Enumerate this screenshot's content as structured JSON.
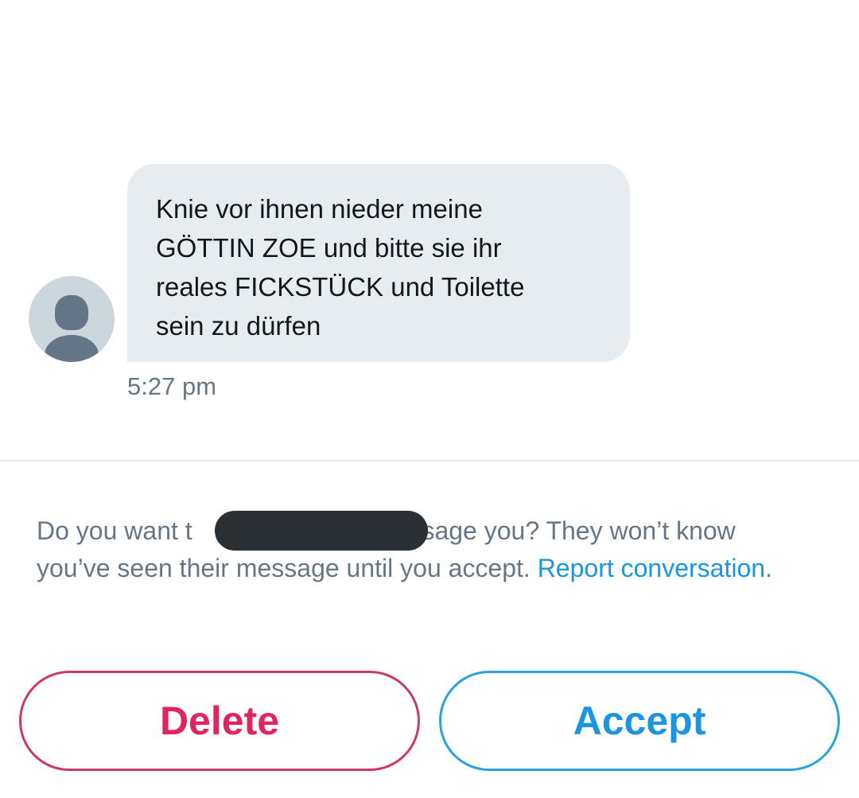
{
  "conversation": {
    "message": {
      "text": "Knie vor ihnen nieder meine GÖTTIN ZOE und bitte sie ihr reales FICKSTÜCK und Toilette sein zu dürfen",
      "time": "5:27 pm"
    }
  },
  "request": {
    "text_before": "Do you want t",
    "text_after": "essage you? They won’t know you’ve seen their message until you accept. ",
    "report_link": "Report conversation."
  },
  "actions": {
    "delete_label": "Delete",
    "accept_label": "Accept"
  },
  "colors": {
    "delete": "#e0245e",
    "accept": "#1b95e0",
    "bubble": "#e6ecf0",
    "secondary_text": "#657786"
  },
  "icons": {
    "avatar": "default-profile-avatar-icon"
  }
}
